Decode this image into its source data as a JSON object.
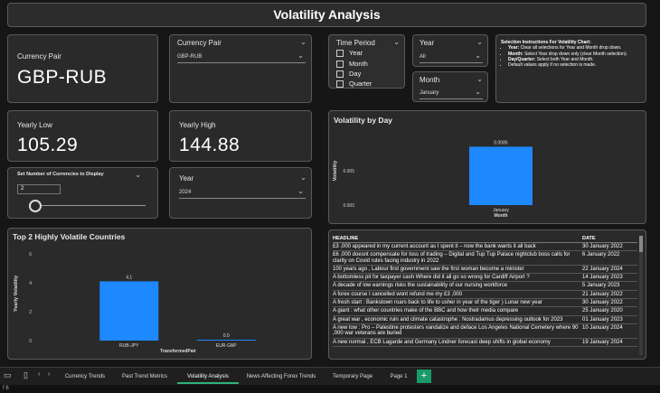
{
  "page": {
    "title": "Volatility Analysis"
  },
  "currency_card": {
    "label": "Currency Pair",
    "value": "GBP-RUB"
  },
  "currency_slicer": {
    "label": "Currency Pair",
    "selected": "GBP-RUB"
  },
  "time_period": {
    "label": "Time Period",
    "options": [
      "Year",
      "Month",
      "Day",
      "Quarter"
    ]
  },
  "year_slicer_top": {
    "label": "Year",
    "selected": "All"
  },
  "month_slicer": {
    "label": "Month",
    "selected": "January"
  },
  "instructions": {
    "title": "Selection Instructions For Volatility Chart:",
    "items": [
      {
        "key": "Year:",
        "text": "Clear all selections for Year and Month drop down."
      },
      {
        "key": "Month:",
        "text": "Select Year drop down only (clear Month selection)."
      },
      {
        "key": "Day/Quarter:",
        "text": "Select both Year and Month."
      },
      {
        "key": "",
        "text": "Default values apply if no selection is made."
      }
    ]
  },
  "yearly_low": {
    "label": "Yearly Low",
    "value": "105.29"
  },
  "yearly_high": {
    "label": "Yearly High",
    "value": "144.88"
  },
  "currencies_slider": {
    "label": "Set Number of Currencies to Display",
    "value": "2",
    "fraction": 0.0
  },
  "year_slicer_bottom": {
    "label": "Year",
    "selected": "2024"
  },
  "vol_by_day": {
    "title": "Volatility by Day",
    "chart_data": {
      "type": "bar",
      "categories": [
        "January"
      ],
      "values": [
        0.0085
      ],
      "data_labels": [
        "0.0085"
      ],
      "ylabel": "Volatility",
      "xlabel": "Month",
      "yticks": [
        "0.000",
        "0.005"
      ],
      "ylim": [
        0,
        0.01
      ],
      "color": "#1e88ff"
    }
  },
  "top_volatile": {
    "title": "Top 2 Highly Volatile Countries",
    "chart_data": {
      "type": "bar",
      "categories": [
        "RUB-JPY",
        "EUR-GBP"
      ],
      "values": [
        4.1,
        0.0
      ],
      "data_labels": [
        "4.1",
        "0.0"
      ],
      "ylabel": "Yearly Volatility",
      "xlabel": "TransformedPair",
      "yticks": [
        "0",
        "2",
        "4",
        "6"
      ],
      "ylim": [
        0,
        6.5
      ],
      "color": "#1e88ff"
    }
  },
  "headlines": {
    "columns": [
      "HEADLINE",
      "DATE"
    ],
    "rows": [
      [
        "£3 ,000 appeared in my current account as I spent it – now the bank wants it all back",
        "30 January 2022"
      ],
      [
        "£6 ,000 doesnt compensate for loss of trading – Digital and Tup Tup Palace nightclub boss calls for clarity on Covid rules facing industry in 2022",
        "6 January 2022"
      ],
      [
        "100 years ago , Labour first government saw the first woman become a minister",
        "22 January 2024"
      ],
      [
        "A bottomless pit for taxpayer cash Where did it all go so wrong for Cardiff Airport ?",
        "14 January 2023"
      ],
      [
        "A decade of low earnings risks the sustainability of our nursing workforce",
        "5 January 2023"
      ],
      [
        "A forex course I cancelled wont refund me my £3 ,000",
        "21 January 2022"
      ],
      [
        "A fresh start : Bankstown roars back to life to usher in year of the tiger ) Lunar new year",
        "30 January 2022"
      ],
      [
        "A giant : what other countries make of the BBC and how their media compare",
        "25 January 2020"
      ],
      [
        "A great war , economic ruin and climate catastrophe : Nostradamus depressing outlook for 2023",
        "01 January 2023"
      ],
      [
        "A new low : Pro – Palestine protesters vandalize and deface Los Angeles National Cemetery where 90 ,000 war veterans are buried",
        "10 January 2024"
      ],
      [
        "A new normal , ECB Lagarde and Germany Lindner forecast deep shifts in global economy",
        "19 January 2024"
      ]
    ]
  },
  "tabs": [
    "Currency Trends",
    "Past Trend Metrics",
    "Volatility Analysis",
    "News Affecting Forex Trends",
    "Temporary Page",
    "Page 1"
  ],
  "active_tab": "Volatility Analysis",
  "add_page_label": "+",
  "colors": {
    "accent": "#1e88ff",
    "tab_active": "#2fb37d",
    "add_tab": "#1a9a6c"
  },
  "status_text": "f 6"
}
